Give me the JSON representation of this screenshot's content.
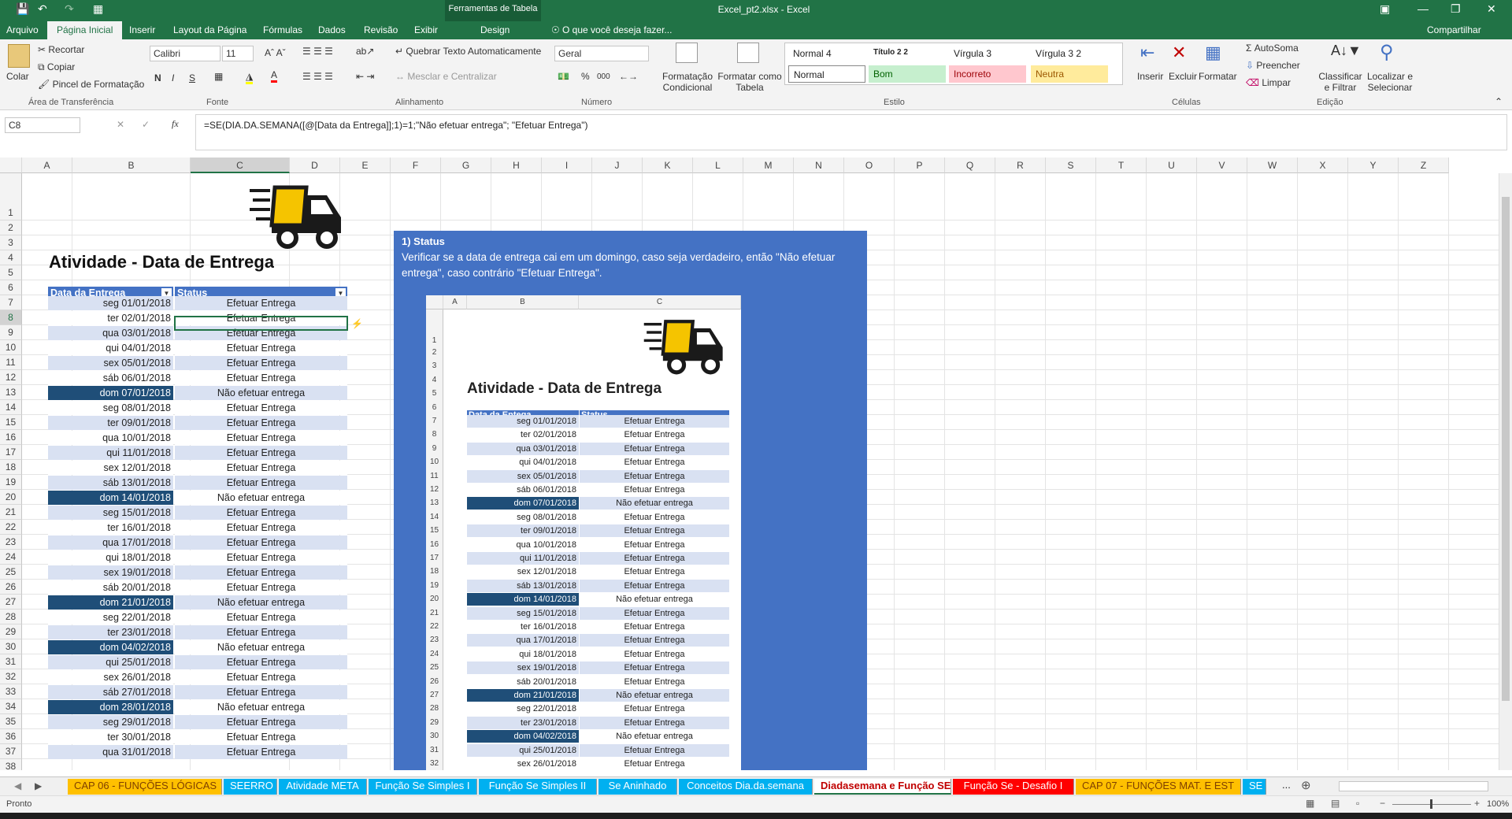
{
  "window": {
    "title": "Excel_pt2.xlsx - Excel",
    "context_tab_group": "Ferramentas de Tabela",
    "share_label": "Compartilhar"
  },
  "tabs": [
    "Arquivo",
    "Página Inicial",
    "Inserir",
    "Layout da Página",
    "Fórmulas",
    "Dados",
    "Revisão",
    "Exibir",
    "Design"
  ],
  "tell_me": "O que você deseja fazer...",
  "ribbon": {
    "clipboard": {
      "paste": "Colar",
      "cut": "Recortar",
      "copy": "Copiar",
      "format_painter": "Pincel de Formatação",
      "label": "Área de Transferência"
    },
    "font": {
      "name": "Calibri",
      "size": "11",
      "label": "Fonte",
      "bold": "N",
      "italic": "I",
      "underline": "S"
    },
    "alignment": {
      "wrap": "Quebrar Texto Automaticamente",
      "merge": "Mesclar e Centralizar",
      "label": "Alinhamento"
    },
    "number": {
      "format": "Geral",
      "label": "Número",
      "percent": "%",
      "thousands": "000"
    },
    "styles_btns": {
      "cond": "Formatação Condicional",
      "table": "Formatar como Tabela"
    },
    "styles": [
      {
        "name": "Normal 4",
        "bg": "#ffffff",
        "fg": "#000000"
      },
      {
        "name": "Título 2 2",
        "bg": "#ffffff",
        "fg": "#000000"
      },
      {
        "name": "Vírgula 3",
        "bg": "#ffffff",
        "fg": "#000000"
      },
      {
        "name": "Vírgula 3 2",
        "bg": "#ffffff",
        "fg": "#000000"
      },
      {
        "name": "Normal",
        "bg": "#ffffff",
        "fg": "#000000"
      },
      {
        "name": "Bom",
        "bg": "#c6efce",
        "fg": "#006100"
      },
      {
        "name": "Incorreto",
        "bg": "#ffc7ce",
        "fg": "#9c0006"
      },
      {
        "name": "Neutra",
        "bg": "#ffeb9c",
        "fg": "#9c5700"
      }
    ],
    "styles_label": "Estilo",
    "cells": {
      "insert": "Inserir",
      "delete": "Excluir",
      "format": "Formatar",
      "label": "Células"
    },
    "editing": {
      "autosum": "AutoSoma",
      "fill": "Preencher",
      "clear": "Limpar",
      "sort": "Classificar e Filtrar",
      "find": "Localizar e Selecionar",
      "label": "Edição"
    }
  },
  "namebox": "C8",
  "formula": "=SE(DIA.DA.SEMANA([@[Data da Entrega]];1)=1;\"Não efetuar entrega\"; \"Efetuar Entrega\")",
  "columns": [
    "A",
    "B",
    "C",
    "D",
    "E",
    "F",
    "G",
    "H",
    "I",
    "J",
    "K",
    "L",
    "M",
    "N",
    "O",
    "P",
    "Q",
    "R",
    "S",
    "T",
    "U",
    "V",
    "W",
    "X",
    "Y",
    "Z"
  ],
  "sheet": {
    "title": "Atividade - Data de Entrega",
    "header_date": "Data da Entrega",
    "header_status": "Status",
    "rows": [
      {
        "r": "7",
        "date": "seg 01/01/2018",
        "status": "Efetuar Entrega",
        "sun": false
      },
      {
        "r": "8",
        "date": "ter 02/01/2018",
        "status": "Efetuar Entrega",
        "sun": false
      },
      {
        "r": "9",
        "date": "qua 03/01/2018",
        "status": "Efetuar Entrega",
        "sun": false
      },
      {
        "r": "10",
        "date": "qui 04/01/2018",
        "status": "Efetuar Entrega",
        "sun": false
      },
      {
        "r": "11",
        "date": "sex 05/01/2018",
        "status": "Efetuar Entrega",
        "sun": false
      },
      {
        "r": "12",
        "date": "sáb 06/01/2018",
        "status": "Efetuar Entrega",
        "sun": false
      },
      {
        "r": "13",
        "date": "dom 07/01/2018",
        "status": "Não efetuar entrega",
        "sun": true
      },
      {
        "r": "14",
        "date": "seg 08/01/2018",
        "status": "Efetuar Entrega",
        "sun": false
      },
      {
        "r": "15",
        "date": "ter 09/01/2018",
        "status": "Efetuar Entrega",
        "sun": false
      },
      {
        "r": "16",
        "date": "qua 10/01/2018",
        "status": "Efetuar Entrega",
        "sun": false
      },
      {
        "r": "17",
        "date": "qui 11/01/2018",
        "status": "Efetuar Entrega",
        "sun": false
      },
      {
        "r": "18",
        "date": "sex 12/01/2018",
        "status": "Efetuar Entrega",
        "sun": false
      },
      {
        "r": "19",
        "date": "sáb 13/01/2018",
        "status": "Efetuar Entrega",
        "sun": false
      },
      {
        "r": "20",
        "date": "dom 14/01/2018",
        "status": "Não efetuar entrega",
        "sun": true
      },
      {
        "r": "21",
        "date": "seg 15/01/2018",
        "status": "Efetuar Entrega",
        "sun": false
      },
      {
        "r": "22",
        "date": "ter 16/01/2018",
        "status": "Efetuar Entrega",
        "sun": false
      },
      {
        "r": "23",
        "date": "qua 17/01/2018",
        "status": "Efetuar Entrega",
        "sun": false
      },
      {
        "r": "24",
        "date": "qui 18/01/2018",
        "status": "Efetuar Entrega",
        "sun": false
      },
      {
        "r": "25",
        "date": "sex 19/01/2018",
        "status": "Efetuar Entrega",
        "sun": false
      },
      {
        "r": "26",
        "date": "sáb 20/01/2018",
        "status": "Efetuar Entrega",
        "sun": false
      },
      {
        "r": "27",
        "date": "dom 21/01/2018",
        "status": "Não efetuar entrega",
        "sun": true
      },
      {
        "r": "28",
        "date": "seg 22/01/2018",
        "status": "Efetuar Entrega",
        "sun": false
      },
      {
        "r": "29",
        "date": "ter 23/01/2018",
        "status": "Efetuar Entrega",
        "sun": false
      },
      {
        "r": "30",
        "date": "dom 04/02/2018",
        "status": "Não efetuar entrega",
        "sun": true
      },
      {
        "r": "31",
        "date": "qui 25/01/2018",
        "status": "Efetuar Entrega",
        "sun": false
      },
      {
        "r": "32",
        "date": "sex 26/01/2018",
        "status": "Efetuar Entrega",
        "sun": false
      },
      {
        "r": "33",
        "date": "sáb 27/01/2018",
        "status": "Efetuar Entrega",
        "sun": false
      },
      {
        "r": "34",
        "date": "dom 28/01/2018",
        "status": "Não efetuar entrega",
        "sun": true
      },
      {
        "r": "35",
        "date": "seg 29/01/2018",
        "status": "Efetuar Entrega",
        "sun": false
      },
      {
        "r": "36",
        "date": "ter 30/01/2018",
        "status": "Efetuar Entrega",
        "sun": false
      },
      {
        "r": "37",
        "date": "qua 31/01/2018",
        "status": "Efetuar Entrega",
        "sun": false
      }
    ]
  },
  "overlay": {
    "heading": "1)  Status",
    "text": "Verificar se a data de entrega cai em um domingo, caso seja verdadeiro, então \"Não efetuar entrega\", caso contrário \"Efetuar Entrega\".",
    "mini_cols": [
      "A",
      "B",
      "C"
    ],
    "mini_title": "Atividade - Data de Entrega",
    "mini_header_date": "Data da Entega",
    "mini_header_status": "Status",
    "mini_rows": [
      {
        "r": "7",
        "date": "seg 01/01/2018",
        "status": "Efetuar Entrega",
        "sun": false
      },
      {
        "r": "8",
        "date": "ter 02/01/2018",
        "status": "Efetuar Entrega",
        "sun": false
      },
      {
        "r": "9",
        "date": "qua 03/01/2018",
        "status": "Efetuar Entrega",
        "sun": false
      },
      {
        "r": "10",
        "date": "qui 04/01/2018",
        "status": "Efetuar Entrega",
        "sun": false
      },
      {
        "r": "11",
        "date": "sex 05/01/2018",
        "status": "Efetuar Entrega",
        "sun": false
      },
      {
        "r": "12",
        "date": "sáb 06/01/2018",
        "status": "Efetuar Entrega",
        "sun": false
      },
      {
        "r": "13",
        "date": "dom 07/01/2018",
        "status": "Não efetuar entrega",
        "sun": true
      },
      {
        "r": "14",
        "date": "seg 08/01/2018",
        "status": "Efetuar Entrega",
        "sun": false
      },
      {
        "r": "15",
        "date": "ter 09/01/2018",
        "status": "Efetuar Entrega",
        "sun": false
      },
      {
        "r": "16",
        "date": "qua 10/01/2018",
        "status": "Efetuar Entrega",
        "sun": false
      },
      {
        "r": "17",
        "date": "qui 11/01/2018",
        "status": "Efetuar Entrega",
        "sun": false
      },
      {
        "r": "18",
        "date": "sex 12/01/2018",
        "status": "Efetuar Entrega",
        "sun": false
      },
      {
        "r": "19",
        "date": "sáb 13/01/2018",
        "status": "Efetuar Entrega",
        "sun": false
      },
      {
        "r": "20",
        "date": "dom 14/01/2018",
        "status": "Não efetuar entrega",
        "sun": true
      },
      {
        "r": "21",
        "date": "seg 15/01/2018",
        "status": "Efetuar Entrega",
        "sun": false
      },
      {
        "r": "22",
        "date": "ter 16/01/2018",
        "status": "Efetuar Entrega",
        "sun": false
      },
      {
        "r": "23",
        "date": "qua 17/01/2018",
        "status": "Efetuar Entrega",
        "sun": false
      },
      {
        "r": "24",
        "date": "qui 18/01/2018",
        "status": "Efetuar Entrega",
        "sun": false
      },
      {
        "r": "25",
        "date": "sex 19/01/2018",
        "status": "Efetuar Entrega",
        "sun": false
      },
      {
        "r": "26",
        "date": "sáb 20/01/2018",
        "status": "Efetuar Entrega",
        "sun": false
      },
      {
        "r": "27",
        "date": "dom 21/01/2018",
        "status": "Não efetuar entrega",
        "sun": true
      },
      {
        "r": "28",
        "date": "seg 22/01/2018",
        "status": "Efetuar Entrega",
        "sun": false
      },
      {
        "r": "29",
        "date": "ter 23/01/2018",
        "status": "Efetuar Entrega",
        "sun": false
      },
      {
        "r": "30",
        "date": "dom 04/02/2018",
        "status": "Não efetuar entrega",
        "sun": true
      },
      {
        "r": "31",
        "date": "qui 25/01/2018",
        "status": "Efetuar Entrega",
        "sun": false
      },
      {
        "r": "32",
        "date": "sex 26/01/2018",
        "status": "Efetuar Entrega",
        "sun": false
      }
    ]
  },
  "sheet_tabs": [
    {
      "label": "CAP 06 - FUNÇÕES LÓGICAS",
      "bg": "#ffc000",
      "fg": "#7f3f00"
    },
    {
      "label": "SEERRO",
      "bg": "#00b0f0",
      "fg": "#ffffff"
    },
    {
      "label": "Atividade META",
      "bg": "#00b0f0",
      "fg": "#ffffff"
    },
    {
      "label": "Função Se Simples I",
      "bg": "#00b0f0",
      "fg": "#ffffff"
    },
    {
      "label": "Função Se Simples II",
      "bg": "#00b0f0",
      "fg": "#ffffff"
    },
    {
      "label": "Se Aninhado",
      "bg": "#00b0f0",
      "fg": "#ffffff"
    },
    {
      "label": "Conceitos Dia.da.semana",
      "bg": "#00b0f0",
      "fg": "#ffffff"
    },
    {
      "label": "Diadasemana e Função SE",
      "bg": "#ffffff",
      "fg": "#c00000"
    },
    {
      "label": "Função Se - Desafio I",
      "bg": "#ff0000",
      "fg": "#ffffff"
    },
    {
      "label": "CAP 07 - FUNÇÕES MAT. E EST",
      "bg": "#ffc000",
      "fg": "#7f3f00"
    },
    {
      "label": "SE",
      "bg": "#00b0f0",
      "fg": "#ffffff"
    }
  ],
  "sheet_tabs_more": "...",
  "status": {
    "ready": "Pronto",
    "zoom": "100%"
  }
}
